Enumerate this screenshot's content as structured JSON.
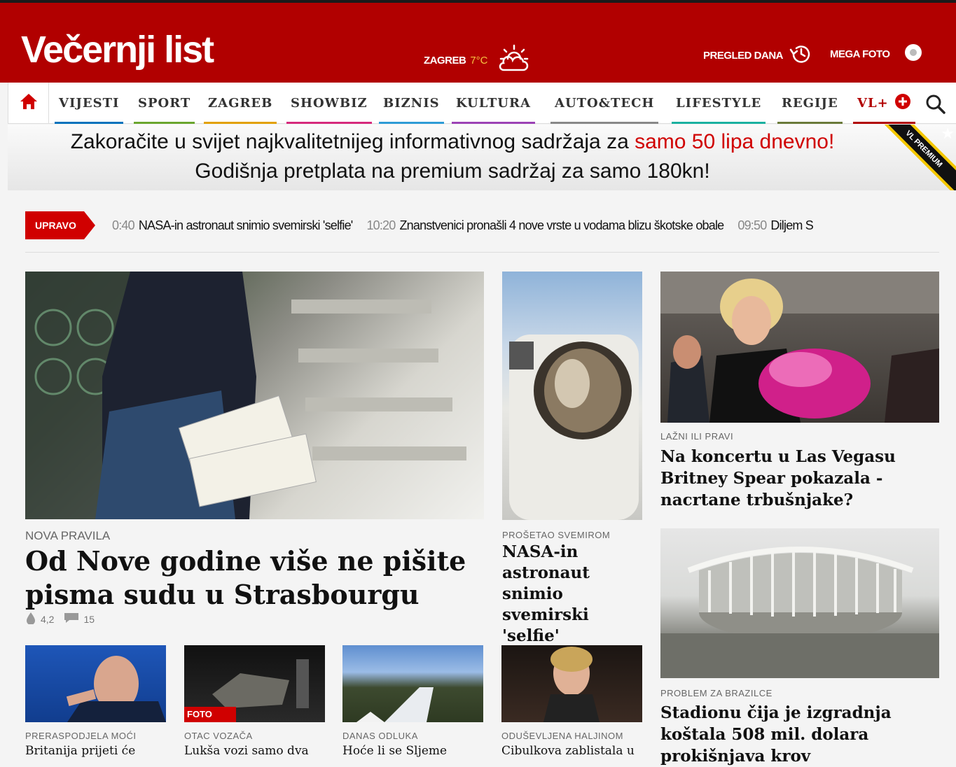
{
  "header": {
    "logo": "Večernji list",
    "weather_city": "ZAGREB",
    "weather_temp": "7°C",
    "pregled_label": "PREGLED DANA",
    "mega_foto_label": "MEGA FOTO"
  },
  "nav": {
    "items": [
      {
        "label": "VIJESTI",
        "color": "#0072bc"
      },
      {
        "label": "SPORT",
        "color": "#6aa52e"
      },
      {
        "label": "ZAGREB",
        "color": "#e2a100"
      },
      {
        "label": "SHOWBIZ",
        "color": "#d62a7c"
      },
      {
        "label": "BIZNIS",
        "color": "#2e9bd6"
      },
      {
        "label": "KULTURA",
        "color": "#9b42b5"
      },
      {
        "label": "AUTO&TECH",
        "color": "#888888"
      },
      {
        "label": "LIFESTYLE",
        "color": "#1ab0a0"
      },
      {
        "label": "REGIJE",
        "color": "#6a7a3a"
      },
      {
        "label": "VL+",
        "color": "#b10000"
      }
    ]
  },
  "premium": {
    "line1_a": "Zakoračite u svijet najkvalitetnijeg informativnog sadržaja za ",
    "line1_b": "samo 50 lipa dnevno!",
    "line2": "Godišnja pretplata na premium sadržaj za samo 180kn!",
    "ribbon": "VL PREMIUM"
  },
  "ticker": {
    "tag": "UPRAVO",
    "items": [
      {
        "time": "0:40",
        "text": "NASA-in astronaut snimio svemirski 'selfie'"
      },
      {
        "time": "10:20",
        "text": "Znanstvenici pronašli 4 nove vrste u vodama blizu škotske obale"
      },
      {
        "time": "09:50",
        "text": "Diljem S"
      }
    ]
  },
  "main": {
    "kicker": "NOVA PRAVILA",
    "title": "Od Nove godine više ne pišite pisma sudu u Strasbourgu",
    "rating": "4,2",
    "comments": "15"
  },
  "astro": {
    "kicker": "PROŠETAO SVEMIROM",
    "title": "NASA-in astronaut snimio svemirski 'selfie'"
  },
  "britney": {
    "kicker": "LAŽNI ILI PRAVI",
    "title": "Na koncertu u Las Vegasu Britney Spear pokazala - nacrtane trbušnjake?"
  },
  "stadium": {
    "kicker": "PROBLEM ZA BRAZILCE",
    "title": "Stadionu čija je izgradnja koštala 508 mil. dolara prokišnjava krov"
  },
  "small": [
    {
      "kicker": "PRERASPODJELA MOĆI",
      "title": "Britanija prijeti će"
    },
    {
      "kicker": "OTAC VOZAČA",
      "title": "Lukša vozi samo dva",
      "badge": "FOTO"
    },
    {
      "kicker": "DANAS ODLUKA",
      "title": "Hoće li se Sljeme"
    },
    {
      "kicker": "ODUŠEVLJENA HALJINOM",
      "title": "Cibulkova zablistala u"
    }
  ]
}
